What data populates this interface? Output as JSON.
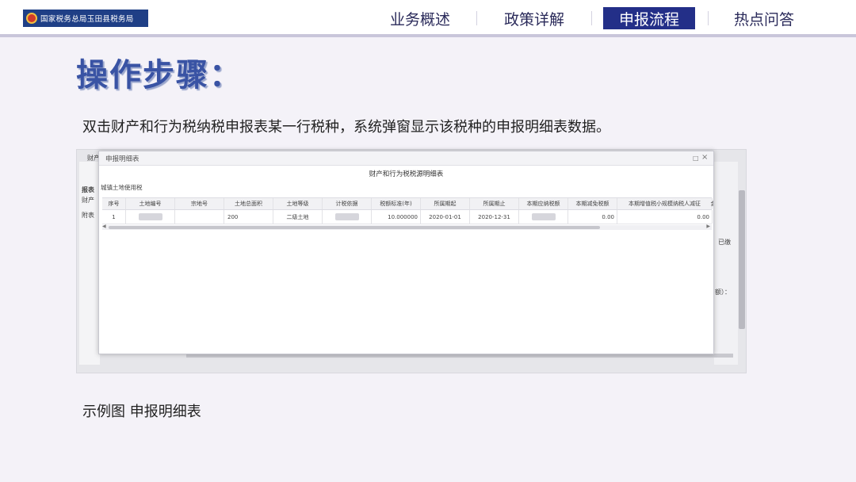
{
  "header": {
    "logo_text": "国家税务总局玉田县税务局",
    "nav": [
      {
        "label": "业务概述",
        "active": false
      },
      {
        "label": "政策详解",
        "active": false
      },
      {
        "label": "申报流程",
        "active": true
      },
      {
        "label": "热点问答",
        "active": false
      }
    ]
  },
  "slide": {
    "title": "操作步骤：",
    "description": "双击财产和行为税纳税申报表某一行税种，系统弹窗显示该税种的申报明细表数据。",
    "caption": "示例图  申报明细表"
  },
  "background_app": {
    "left_labels": [
      "财产",
      "报表",
      "财产",
      "附表"
    ],
    "right_labels": [
      "已缴",
      "额）："
    ]
  },
  "modal": {
    "title": "申报明细表",
    "minimize_icon": "minimize-icon",
    "close_icon": "close-icon",
    "report_title": "财产和行为税税源明细表",
    "tax_type": "城镇土地使用税",
    "columns": [
      "序号",
      "土地编号",
      "宗地号",
      "土地总面积",
      "土地等级",
      "计税依据",
      "税额标准(年)",
      "所属期起",
      "所属期止",
      "本期应纳税额",
      "本期减免税额",
      "本期增值税小规模纳税人减征",
      "金额单"
    ],
    "rows": [
      [
        "1",
        "",
        "",
        "200",
        "二级土地",
        "",
        "10.000000",
        "2020-01-01",
        "2020-12-31",
        "",
        "0.00",
        "0.00",
        ""
      ]
    ]
  },
  "colors": {
    "brand": "#1f3f86",
    "nav_active": "#232f88",
    "title": "#3953a4"
  }
}
